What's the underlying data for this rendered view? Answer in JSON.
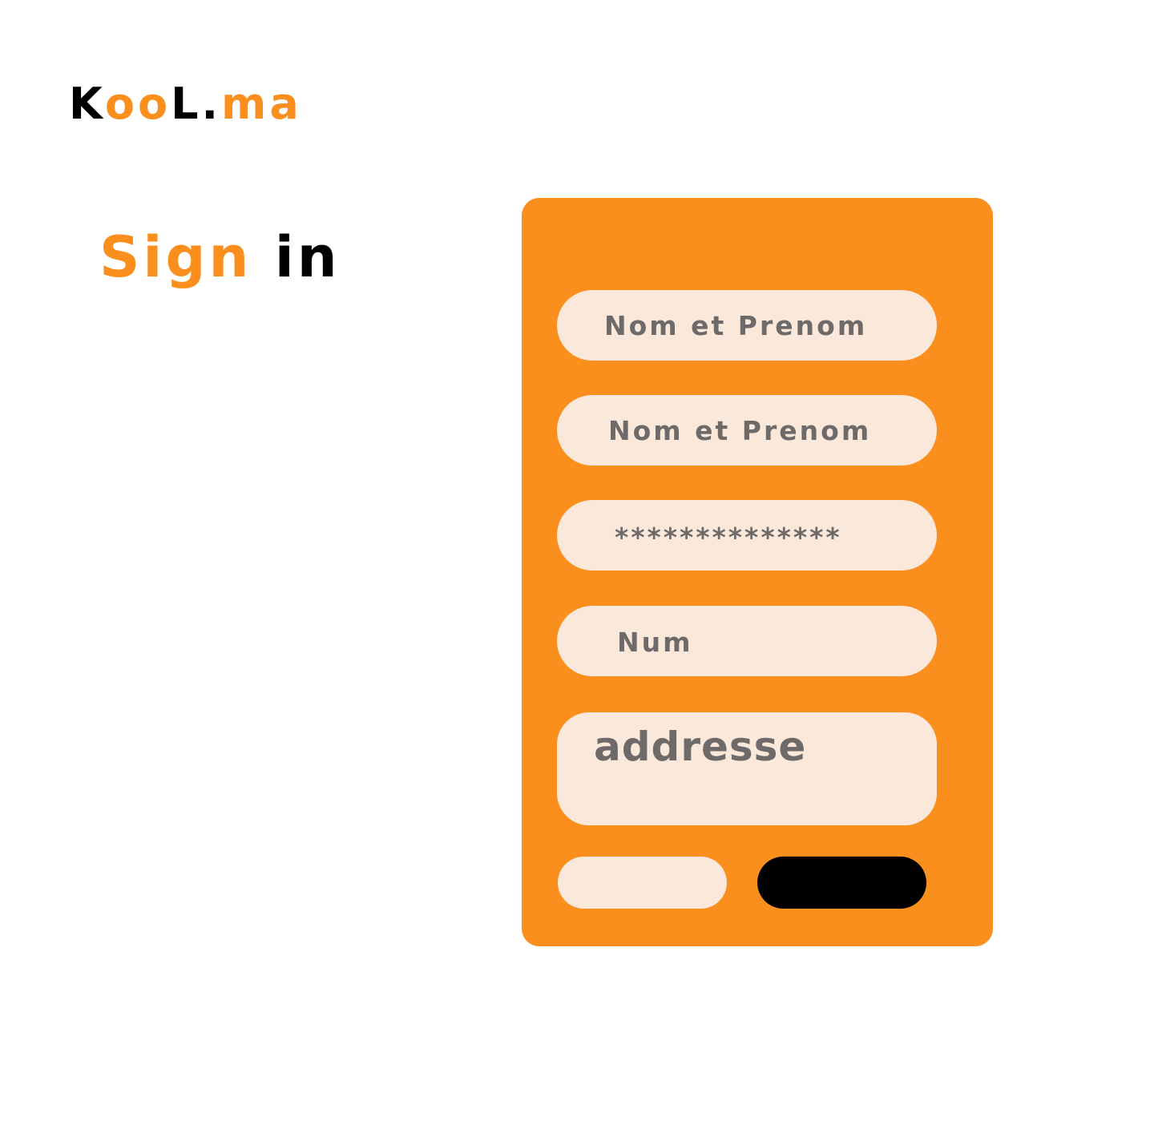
{
  "brand": {
    "logo_part1": "K",
    "logo_part2": "oo",
    "logo_part3": "L.",
    "logo_part4": "ma",
    "accent_color": "#fb8f1e",
    "text_color": "#000000"
  },
  "page": {
    "title_part1": "Sign",
    "title_part2": "in"
  },
  "form": {
    "background_color": "#fb8f1e",
    "field_color": "#fae8da",
    "fields": [
      {
        "value": "Nom et Prenom"
      },
      {
        "value": "Nom et Prenom"
      },
      {
        "value": "**************"
      },
      {
        "value": "Num"
      },
      {
        "value": "addresse"
      }
    ],
    "buttons": {
      "secondary_label": "",
      "primary_label": ""
    }
  }
}
